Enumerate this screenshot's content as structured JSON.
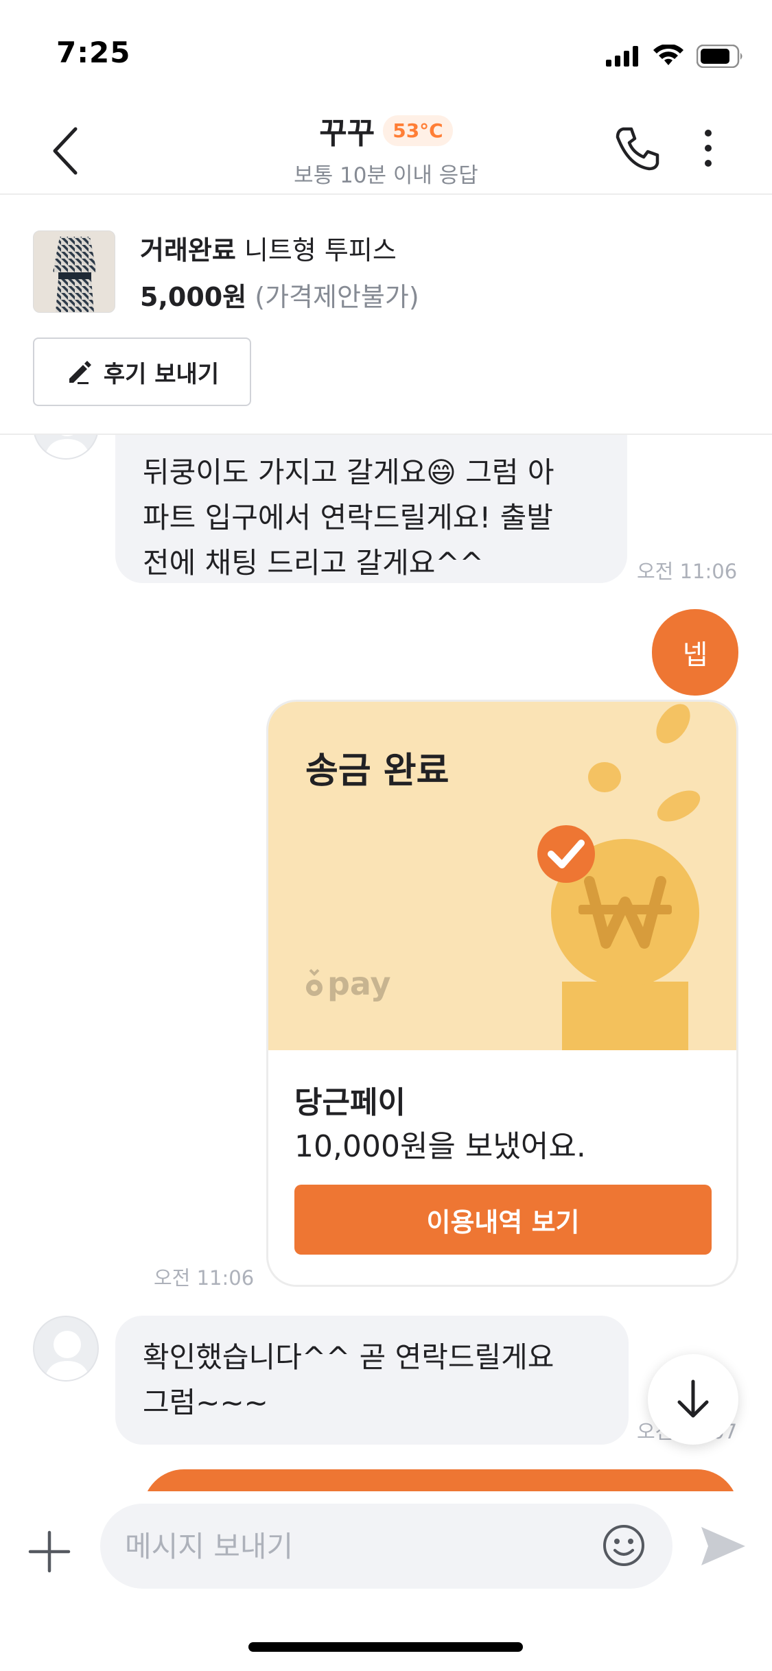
{
  "status_bar": {
    "time": "7:25"
  },
  "header": {
    "name": "꾸꾸",
    "temperature": "53°C",
    "response_time": "보통 10분 이내 응답"
  },
  "product": {
    "status": "거래완료",
    "title": "니트형 투피스",
    "price": "5,000원",
    "negotiation": "(가격제안불가)",
    "review_button": "후기 보내기"
  },
  "messages": {
    "m1": {
      "line1": "뒤쿵이도 가지고 갈게요",
      "emoji": "😄",
      "line1_tail": " 그럼 아",
      "line2": "파트 입구에서 연락드릴게요! 출발",
      "line3": "전에 채팅 드리고 갈게요^^",
      "time": "오전 11:06"
    },
    "m2": {
      "text": "넵"
    },
    "m3": {
      "card_title": "송금 완료",
      "logo": "pay",
      "service": "당근페이",
      "description": "10,000원을 보냈어요.",
      "button": "이용내역 보기",
      "time": "오전 11:06"
    },
    "m4": {
      "line1": "확인했습니다^^ 곧 연락드릴게요",
      "line2": "그럼~~~",
      "time": "오전 11:07"
    }
  },
  "input": {
    "placeholder": "메시지 보내기"
  },
  "colors": {
    "accent": "#ee7633",
    "bubble": "#f2f3f6",
    "muted": "#868b94",
    "pay_bg": "#fae3b5"
  }
}
